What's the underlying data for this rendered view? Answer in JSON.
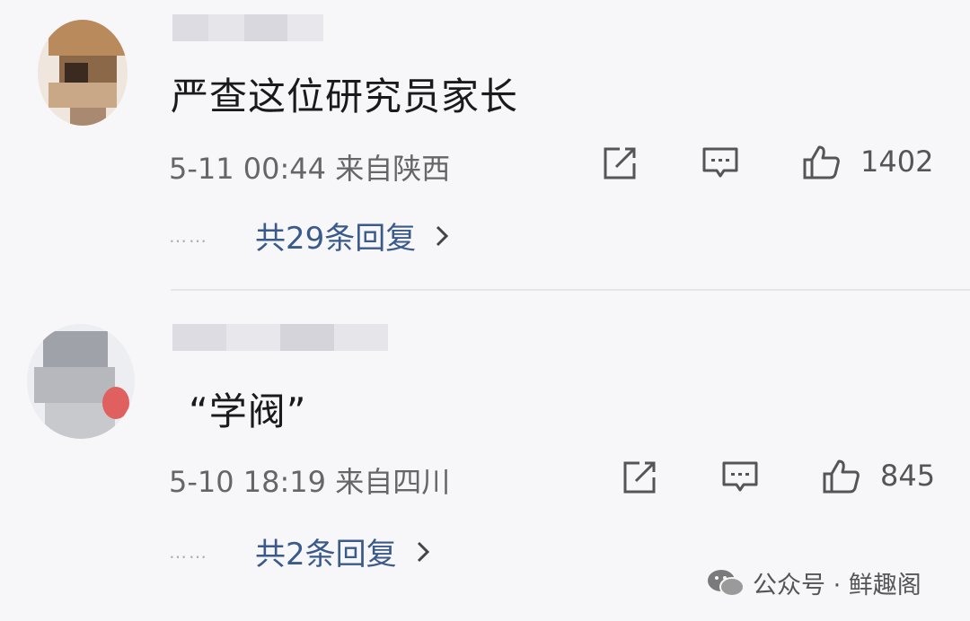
{
  "comments": [
    {
      "text": "严查这位研究员家长",
      "meta": "5-11 00:44 来自陕西",
      "likes": "1402",
      "replies_label": "共29条回复",
      "dots": "……"
    },
    {
      "text": "“学阀”",
      "meta": "5-10 18:19 来自四川",
      "likes": "845",
      "replies_label": "共2条回复",
      "dots": "……"
    }
  ],
  "watermark": {
    "label": "公众号 · 鲜趣阁"
  },
  "colors": {
    "background": "#f7f7f9",
    "link": "#3a5a8c",
    "meta": "#666666",
    "text": "#1a1a1a"
  },
  "icons": [
    "share-icon",
    "comment-icon",
    "like-icon",
    "chevron-right-icon",
    "wechat-icon"
  ]
}
